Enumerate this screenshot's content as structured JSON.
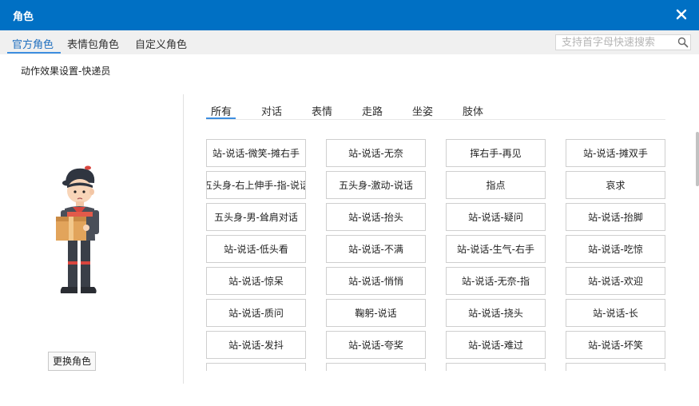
{
  "window": {
    "title": "角色"
  },
  "tabs": [
    {
      "label": "官方角色",
      "active": true
    },
    {
      "label": "表情包角色",
      "active": false
    },
    {
      "label": "自定义角色",
      "active": false
    }
  ],
  "search": {
    "placeholder": "支持首字母快速搜索",
    "value": ""
  },
  "subtitle": "动作效果设置-快递员",
  "character": {
    "change_button_label": "更换角色"
  },
  "categories": [
    {
      "label": "所有",
      "active": true
    },
    {
      "label": "对话",
      "active": false
    },
    {
      "label": "表情",
      "active": false
    },
    {
      "label": "走路",
      "active": false
    },
    {
      "label": "坐姿",
      "active": false
    },
    {
      "label": "肢体",
      "active": false
    }
  ],
  "actions": [
    "站-说话-微笑-摊右手",
    "站-说话-无奈",
    "挥右手-再见",
    "站-说话-摊双手",
    "五头身-右上伸手-指-说话",
    "五头身-激动-说话",
    "指点",
    "哀求",
    "五头身-男-耸肩对话",
    "站-说话-抬头",
    "站-说话-疑问",
    "站-说话-抬脚",
    "站-说话-低头看",
    "站-说话-不满",
    "站-说话-生气-右手",
    "站-说话-吃惊",
    "站-说话-惊呆",
    "站-说话-悄悄",
    "站-说话-无奈-指",
    "站-说话-欢迎",
    "站-说话-质问",
    "鞠躬-说话",
    "站-说话-挠头",
    "站-说话-长",
    "站-说话-发抖",
    "站-说话-夸奖",
    "站-说话-难过",
    "站-说话-坏笑",
    "",
    "",
    "",
    ""
  ],
  "colors": {
    "titlebar": "#0070c4",
    "accent": "#3d8ee0",
    "active_tab_text": "#1f6fbf"
  },
  "icons": {
    "close": "close-icon",
    "search": "search-icon"
  }
}
